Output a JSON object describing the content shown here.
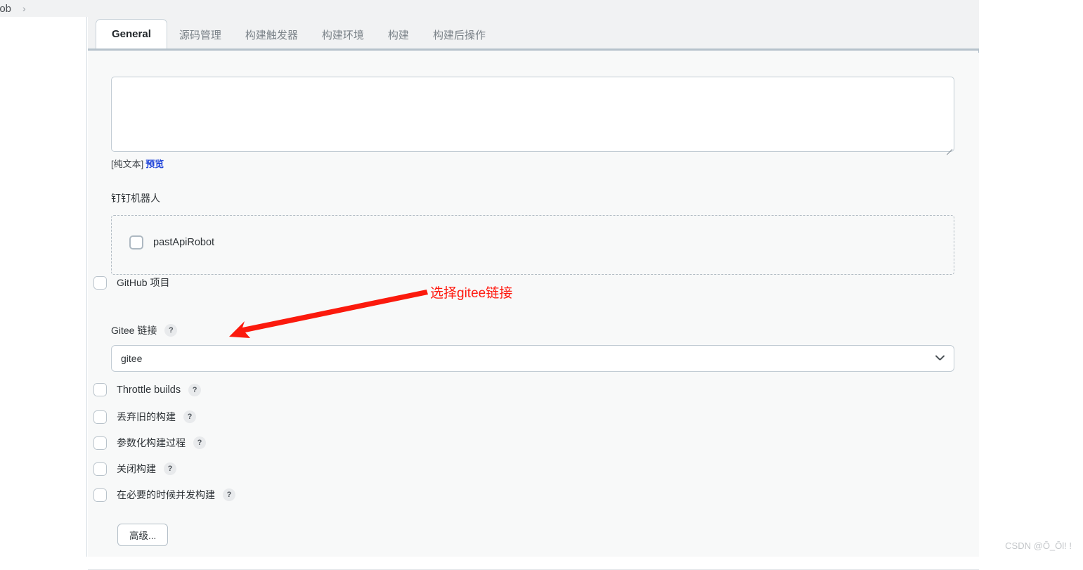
{
  "breadcrumb": {
    "current": "lob",
    "separator": "›"
  },
  "tabs": [
    {
      "label": "General",
      "active": true
    },
    {
      "label": "源码管理",
      "active": false
    },
    {
      "label": "构建触发器",
      "active": false
    },
    {
      "label": "构建环境",
      "active": false
    },
    {
      "label": "构建",
      "active": false
    },
    {
      "label": "构建后操作",
      "active": false
    }
  ],
  "description": {
    "value": "",
    "placeholder": ""
  },
  "plaintext": {
    "format_label": "[纯文本]",
    "preview_link": "预览"
  },
  "dingtalk": {
    "section_label": "钉钉机器人",
    "robot_label": "pastApiRobot",
    "robot_checked": false
  },
  "github": {
    "label": "GitHub 项目",
    "checked": false
  },
  "gitee": {
    "label": "Gitee 链接",
    "help": "?",
    "selected_value": "gitee",
    "chevron_icon": "chevron-down-icon"
  },
  "options": [
    {
      "label": "Throttle builds",
      "help": "?",
      "checked": false,
      "lang": "en"
    },
    {
      "label": "丢弃旧的构建",
      "help": "?",
      "checked": false,
      "lang": "zh"
    },
    {
      "label": "参数化构建过程",
      "help": "?",
      "checked": false,
      "lang": "zh"
    },
    {
      "label": "关闭构建",
      "help": "?",
      "checked": false,
      "lang": "zh"
    },
    {
      "label": "在必要的时候并发构建",
      "help": "?",
      "checked": false,
      "lang": "zh"
    }
  ],
  "advanced_button": {
    "label": "高级..."
  },
  "annotation": {
    "text": "选择gitee链接",
    "color": "#ff1a10"
  },
  "watermark": {
    "text": "CSDN @Ō_Ōl! !"
  },
  "colors": {
    "tab_bar_bg": "#f1f2f3",
    "panel_bg": "#f8f9f9",
    "tab_underline": "#b6c2cb",
    "link_blue": "#1d42d9",
    "annotation_red": "#ff1a10",
    "checkbox_border": "#aeb9c2"
  }
}
